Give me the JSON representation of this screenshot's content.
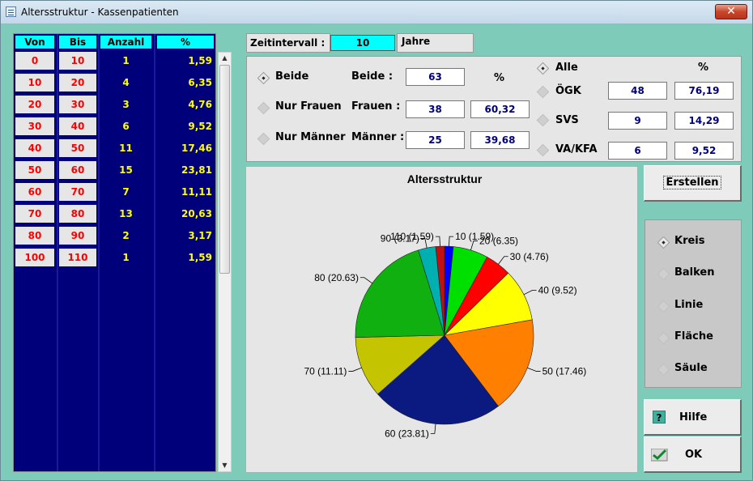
{
  "window": {
    "title": "Altersstruktur - Kassenpatienten",
    "close_label": "✕"
  },
  "table": {
    "headers": [
      "Von",
      "Bis",
      "Anzahl",
      "%"
    ],
    "rows": [
      {
        "von": "0",
        "bis": "10",
        "anzahl": "1",
        "pct": "1,59"
      },
      {
        "von": "10",
        "bis": "20",
        "anzahl": "4",
        "pct": "6,35"
      },
      {
        "von": "20",
        "bis": "30",
        "anzahl": "3",
        "pct": "4,76"
      },
      {
        "von": "30",
        "bis": "40",
        "anzahl": "6",
        "pct": "9,52"
      },
      {
        "von": "40",
        "bis": "50",
        "anzahl": "11",
        "pct": "17,46"
      },
      {
        "von": "50",
        "bis": "60",
        "anzahl": "15",
        "pct": "23,81"
      },
      {
        "von": "60",
        "bis": "70",
        "anzahl": "7",
        "pct": "11,11"
      },
      {
        "von": "70",
        "bis": "80",
        "anzahl": "13",
        "pct": "20,63"
      },
      {
        "von": "80",
        "bis": "90",
        "anzahl": "2",
        "pct": "3,17"
      },
      {
        "von": "100",
        "bis": "110",
        "anzahl": "1",
        "pct": "1,59"
      }
    ]
  },
  "zeitintervall": {
    "label": "Zeitintervall :",
    "value": "10",
    "unit": "Jahre"
  },
  "filter": {
    "gender": [
      {
        "label": "Beide",
        "selected": true,
        "field_label": "Beide :",
        "count": "63",
        "pct": ""
      },
      {
        "label": "Nur Frauen",
        "selected": false,
        "field_label": "Frauen :",
        "count": "38",
        "pct": "60,32"
      },
      {
        "label": "Nur Männer",
        "selected": false,
        "field_label": "Männer :",
        "count": "25",
        "pct": "39,68"
      }
    ],
    "pct_header": "%",
    "insurer_pct_header": "%",
    "insurers": [
      {
        "label": "Alle",
        "selected": true,
        "count": "",
        "pct": ""
      },
      {
        "label": "ÖGK",
        "selected": false,
        "count": "48",
        "pct": "76,19"
      },
      {
        "label": "SVS",
        "selected": false,
        "count": "9",
        "pct": "14,29"
      },
      {
        "label": "VA/KFA",
        "selected": false,
        "count": "6",
        "pct": "9,52"
      }
    ]
  },
  "chart_data": {
    "type": "pie",
    "title": "Altersstruktur",
    "categories": [
      "10",
      "20",
      "30",
      "40",
      "50",
      "60",
      "70",
      "80",
      "90",
      "110"
    ],
    "values": [
      1.59,
      6.35,
      4.76,
      9.52,
      17.46,
      23.81,
      11.11,
      20.63,
      3.17,
      1.59
    ],
    "labels": [
      "10 (1.59)",
      "20 (6.35)",
      "30 (4.76)",
      "40 (9.52)",
      "50 (17.46)",
      "60 (23.81)",
      "70 (11.11)",
      "80 (20.63)",
      "90 (3.17)",
      "110 (1.59)"
    ],
    "colors": [
      "#0000ff",
      "#00e000",
      "#ff0000",
      "#ffff00",
      "#ff8000",
      "#0a1a80",
      "#c4c400",
      "#10b010",
      "#00b0b0",
      "#c01010"
    ]
  },
  "buttons": {
    "erstellen": "Erstellen",
    "hilfe": "Hilfe",
    "ok": "OK",
    "hilfe_icon": "?"
  },
  "chart_types": [
    {
      "label": "Kreis",
      "selected": true
    },
    {
      "label": "Balken",
      "selected": false
    },
    {
      "label": "Linie",
      "selected": false
    },
    {
      "label": "Fläche",
      "selected": false
    },
    {
      "label": "Säule",
      "selected": false
    }
  ]
}
